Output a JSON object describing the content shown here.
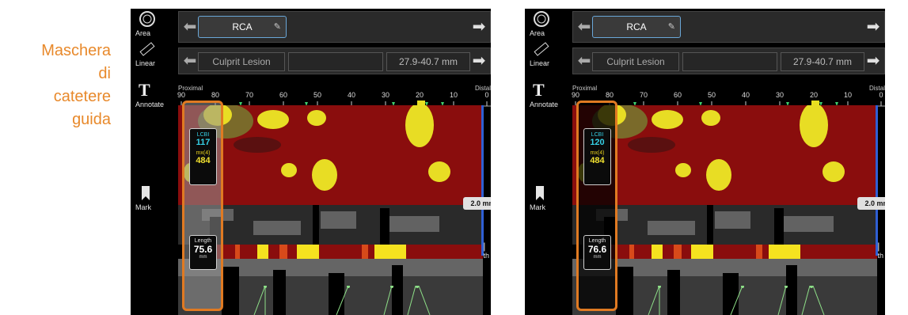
{
  "annotation": {
    "line1": "Maschera di",
    "line2": "catetere",
    "line3": "guida",
    "color": "#e8892b"
  },
  "panels": [
    {
      "tools": {
        "area": "Area",
        "linear": "Linear",
        "annotate": "Annotate",
        "mark": "Mark",
        "length": "Length"
      },
      "vessel": "RCA",
      "lesion": "Culprit Lesion",
      "range": "27.9-40.7 mm",
      "scale": {
        "proximal": "Proximal",
        "distal": "Distal",
        "ticks": [
          "90",
          "80",
          "70",
          "60",
          "50",
          "40",
          "30",
          "20",
          "10",
          "0"
        ]
      },
      "lcbi_label": "LCBI",
      "lcbi_value": "117",
      "mx_label": "mx(4)",
      "mx_value": "484",
      "length_label": "Length",
      "length_value": "75.6",
      "length_unit": "mm",
      "mm_badge": "2.0 mm",
      "mask_style": "grey"
    },
    {
      "tools": {
        "area": "Area",
        "linear": "Linear",
        "annotate": "Annotate",
        "mark": "Mark",
        "length": "Length"
      },
      "vessel": "RCA",
      "lesion": "Culprit Lesion",
      "range": "27.9-40.7 mm",
      "scale": {
        "proximal": "Proximal",
        "distal": "Distal",
        "ticks": [
          "90",
          "80",
          "70",
          "60",
          "50",
          "40",
          "30",
          "20",
          "10",
          "0"
        ]
      },
      "lcbi_label": "LCBI",
      "lcbi_value": "120",
      "mx_label": "mx(4)",
      "mx_value": "484",
      "length_label": "Length",
      "length_value": "76.6",
      "length_unit": "mm",
      "mm_badge": "2.0 mm",
      "mask_style": "black"
    }
  ],
  "icons": [
    "area-icon",
    "linear-ruler-icon",
    "annotate-icon",
    "mark-bookmark-icon",
    "length-icon",
    "edit-pencil-icon",
    "arrow-left-icon",
    "arrow-right-icon"
  ],
  "colors": {
    "mask_outline": "#e07a22",
    "heatmap_bg": "#8a0d0d",
    "lipid_yellow": "#f5e21f",
    "lcbi_cyan": "#36d0e6",
    "accent_blue": "#6aa7d8"
  }
}
